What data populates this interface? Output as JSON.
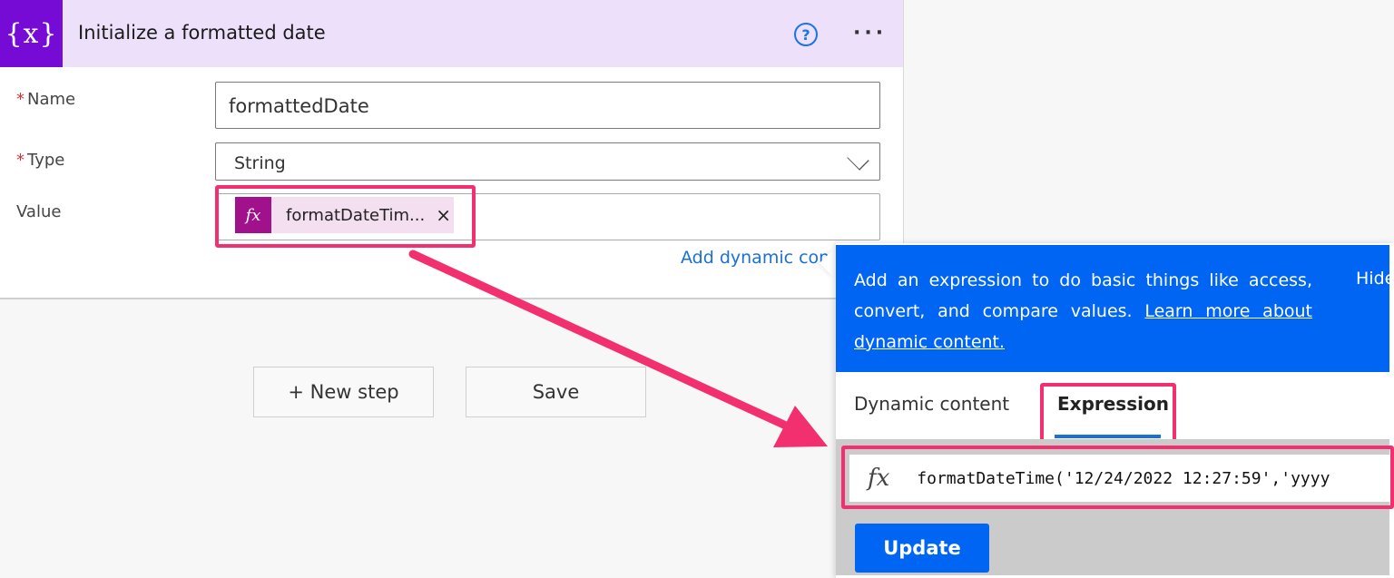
{
  "card": {
    "header": {
      "icon": "variable-braces-icon",
      "icon_text": "{x}",
      "title": "Initialize a formatted date",
      "help_icon": "question-circle-icon",
      "more_icon": "ellipsis-icon",
      "more_text": "…",
      "color": "#ede0fa",
      "icon_color": "#770bd6"
    },
    "fields": {
      "name": {
        "required_mark": "*",
        "label": "Name",
        "value": "formattedDate"
      },
      "type": {
        "required_mark": "*",
        "label": "Type",
        "value": "String"
      },
      "value": {
        "label": "Value",
        "token": {
          "icon_text": "fx",
          "text": "formatDateTim...",
          "remove": "×"
        }
      }
    },
    "add_dynamic_content": "Add dynamic content"
  },
  "buttons": {
    "new_step": "+ New step",
    "save": "Save"
  },
  "expression_panel": {
    "info": {
      "text": "Add an expression to do basic things like access, convert, and compare values. ",
      "link": "Learn more about dynamic content.",
      "hide": "Hide"
    },
    "tabs": [
      {
        "label": "Dynamic content",
        "active": false
      },
      {
        "label": "Expression",
        "active": true
      }
    ],
    "expression": {
      "icon_text": "fx",
      "value": "formatDateTime('12/24/2022 12:27:59','yyyy"
    },
    "update_label": "Update",
    "accent": "#0065f2"
  },
  "annotations": {
    "highlight_color": "#f2306f"
  }
}
